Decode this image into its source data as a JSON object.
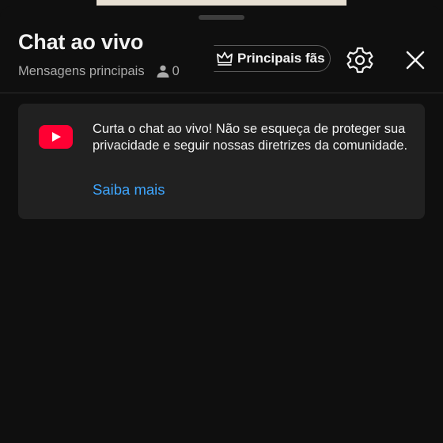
{
  "header": {
    "title": "Chat ao vivo",
    "subtitle": "Mensagens principais",
    "viewer_count": "0",
    "fans_button_label": "Principais fãs"
  },
  "icons": {
    "viewer": "person-icon",
    "fans": "crown-icon",
    "settings": "gear-icon",
    "close": "close-icon",
    "logo": "youtube-logo-icon"
  },
  "notice": {
    "message": "Curta o chat ao vivo! Não se esqueça de proteger sua privacidade e seguir nossas diretrizes da comunidade.",
    "link_label": "Saiba mais"
  },
  "colors": {
    "background": "#0f0f0f",
    "card": "#212121",
    "link": "#3ea6ff",
    "youtube_red": "#ff0033",
    "text_primary": "#f1f1f1",
    "text_secondary": "#aaaaaa"
  }
}
